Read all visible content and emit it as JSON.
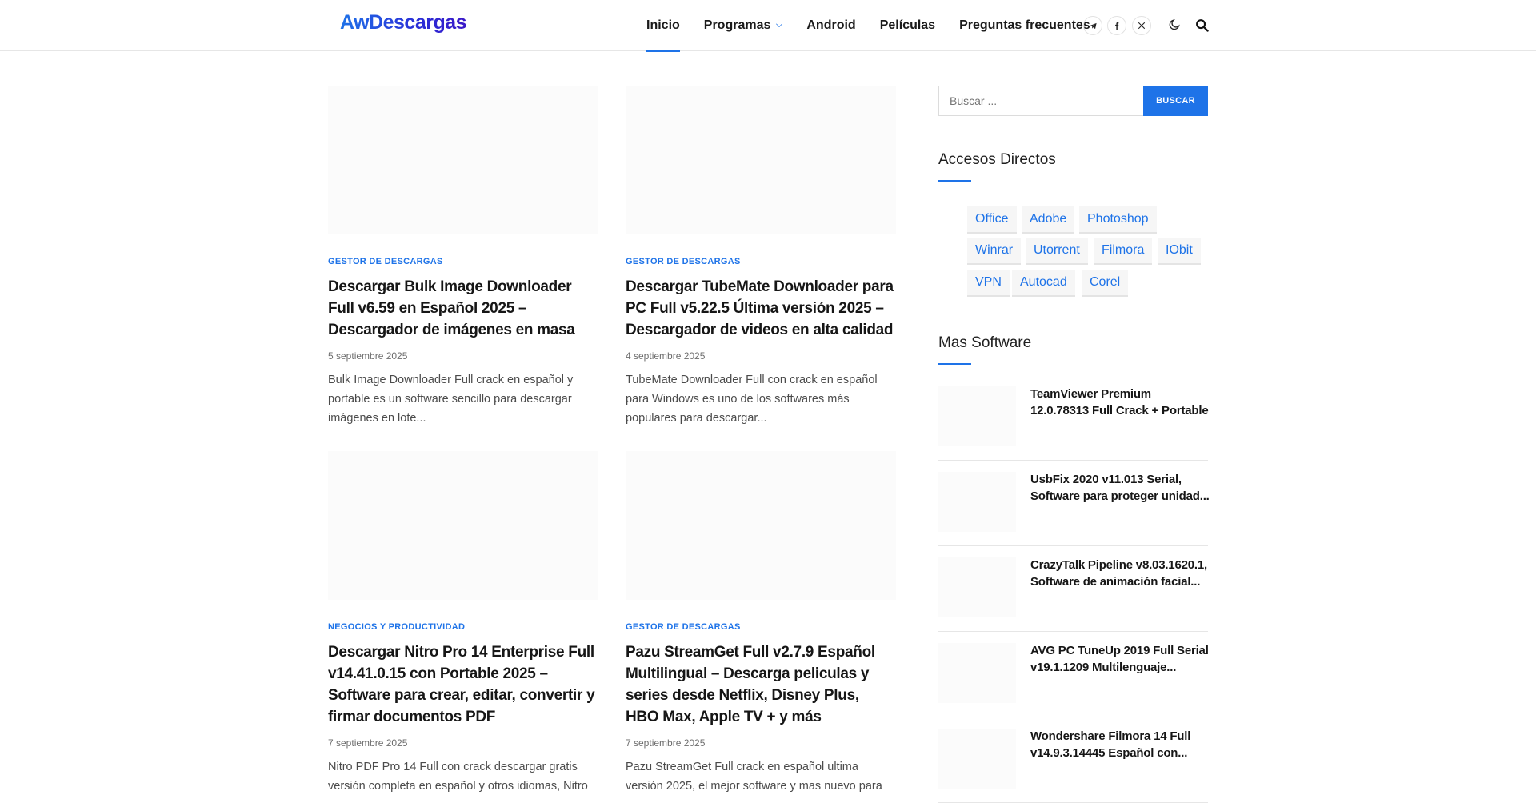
{
  "header": {
    "logo": "AwDescargas",
    "nav": [
      {
        "label": "Inicio"
      },
      {
        "label": "Programas"
      },
      {
        "label": "Android"
      },
      {
        "label": "Películas"
      },
      {
        "label": "Preguntas frecuentes"
      }
    ],
    "icons": [
      "telegram-icon",
      "facebook-icon",
      "x-icon",
      "moon-icon",
      "search-icon"
    ]
  },
  "posts": [
    {
      "category": "GESTOR DE DESCARGAS",
      "title": "Descargar Bulk Image Downloader Full v6.59 en Español 2025 – Descargador de imágenes en masa",
      "date": "5 septiembre 2025",
      "excerpt": "Bulk Image Downloader Full crack en español y portable es un software sencillo para descargar imágenes en lote..."
    },
    {
      "category": "GESTOR DE DESCARGAS",
      "title": "Descargar TubeMate Downloader para PC Full v5.22.5 Última versión 2025 – Descargador de videos en alta calidad",
      "date": "4 septiembre 2025",
      "excerpt": "TubeMate Downloader Full con crack en español para Windows es uno de los softwares más populares para descargar..."
    },
    {
      "category": "NEGOCIOS Y PRODUCTIVIDAD",
      "title": "Descargar Nitro Pro 14 Enterprise Full v14.41.0.15 con Portable 2025 – Software para crear, editar, convertir y firmar documentos PDF",
      "date": "7 septiembre 2025",
      "excerpt": "Nitro PDF Pro 14 Full con crack descargar gratis versión completa en español y otros idiomas, Nitro"
    },
    {
      "category": "GESTOR DE DESCARGAS",
      "title": "Pazu StreamGet Full v2.7.9 Español Multilingual – Descarga peliculas y series desde Netflix, Disney Plus, HBO Max, Apple TV + y más",
      "date": "7 septiembre 2025",
      "excerpt": "Pazu StreamGet Full crack en español ultima versión 2025, el mejor software y mas nuevo para"
    }
  ],
  "sidebar": {
    "search_placeholder": "Buscar ...",
    "search_button": "BUSCAR",
    "shortcuts_title": "Accesos Directos",
    "tags": [
      "Office",
      "Adobe",
      "Photoshop",
      "Winrar",
      "Utorrent",
      "Filmora",
      "IObit",
      "VPN",
      "Autocad",
      "Corel"
    ],
    "more_title": "Mas Software",
    "more": [
      {
        "title": "TeamViewer Premium 12.0.78313 Full Crack + Portable"
      },
      {
        "title": "UsbFix 2020 v11.013 Serial, Software para proteger unidad..."
      },
      {
        "title": "CrazyTalk Pipeline v8.03.1620.1, Software de animación facial..."
      },
      {
        "title": "AVG PC TuneUp 2019 Full Serial v19.1.1209 Multilenguaje..."
      },
      {
        "title": "Wondershare Filmora 14 Full v14.9.3.14445 Español con..."
      }
    ]
  },
  "colors": {
    "accent": "#1e73e8",
    "text": "#161616",
    "muted": "#6d6d6d"
  }
}
